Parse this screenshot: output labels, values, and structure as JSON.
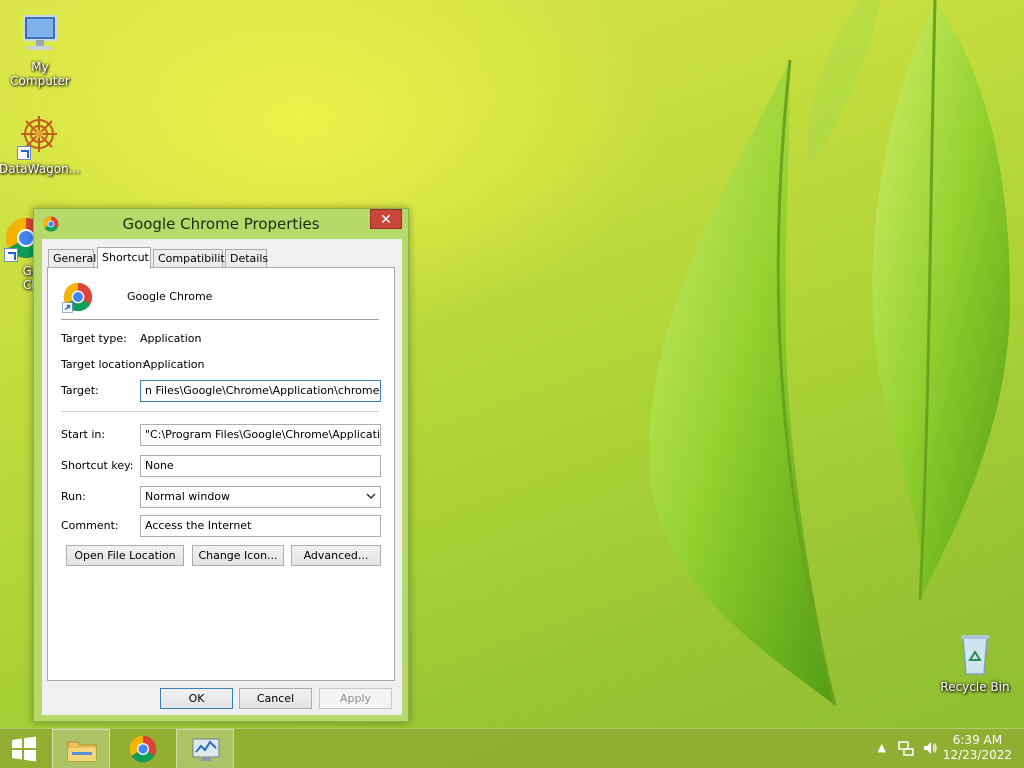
{
  "desktop": {
    "icons": [
      {
        "label": "My Computer"
      },
      {
        "label": "DataWagon..."
      },
      {
        "label_top": "Go",
        "label_bottom": "Ch"
      },
      {
        "label": "Recycle Bin"
      }
    ]
  },
  "dialog": {
    "title": "Google Chrome Properties",
    "close_symbol": "✕",
    "tabs": [
      {
        "label": "General"
      },
      {
        "label": "Shortcut"
      },
      {
        "label": "Compatibility"
      },
      {
        "label": "Details"
      }
    ],
    "app_name": "Google Chrome",
    "target_type_label": "Target type:",
    "target_type_value": "Application",
    "target_location_label": "Target location:",
    "target_location_value": "Application",
    "target_label": "Target:",
    "target_value": "n Files\\Google\\Chrome\\Application\\chrome.exe\"",
    "start_in_label": "Start in:",
    "start_in_value": "\"C:\\Program Files\\Google\\Chrome\\Application\"",
    "shortcut_key_label": "Shortcut key:",
    "shortcut_key_value": "None",
    "run_label": "Run:",
    "run_value": "Normal window",
    "comment_label": "Comment:",
    "comment_value": "Access the Internet",
    "open_file_location": "Open File Location",
    "change_icon": "Change Icon...",
    "advanced": "Advanced...",
    "ok": "OK",
    "cancel": "Cancel",
    "apply": "Apply"
  },
  "taskbar": {
    "time": "6:39 AM",
    "date": "12/23/2022",
    "tray_arrow": "▲"
  }
}
